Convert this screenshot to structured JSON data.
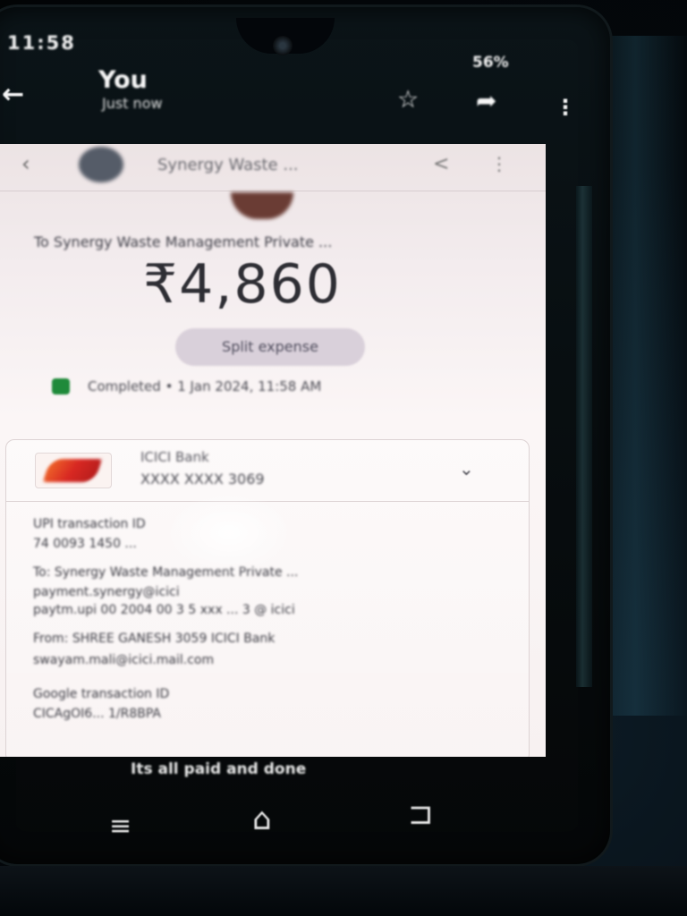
{
  "status_bar": {
    "time": "11:58",
    "right": "56%"
  },
  "app_bar": {
    "title": "You",
    "subtitle": "Just now"
  },
  "icons": {
    "back": "arrow-left-icon",
    "star": "star-icon",
    "share": "share-icon",
    "more": "more-vert-icon"
  },
  "transaction": {
    "merchant_short": "Synergy Waste ...",
    "paid_to": "To Synergy Waste Management Private ...",
    "amount": "₹4,860",
    "split_label": "Split expense",
    "status_text": "Completed • 1 Jan 2024, 11:58 AM",
    "bank_name": "ICICI Bank",
    "account": "XXXX XXXX 3069",
    "details": [
      "UPI transaction ID",
      "74 0093 1450 ...",
      "To: Synergy Waste Management Private ...",
      "payment.synergy@icici",
      "paytm.upi 00 2004 00 3 5 xxx ... 3 @ icici",
      "From: SHREE GANESH 3059 ICICI Bank",
      "swayam.mali@icici.mail.com",
      "Google transaction ID",
      "CICAgOI6... 1/R8BPA"
    ]
  },
  "nav": {
    "hint": "Its all paid and done",
    "recent": "≡",
    "home": "⌂",
    "back": "⊐"
  },
  "colors": {
    "screen_bg": "#f6f0f0",
    "amount_text": "#2e2e34",
    "completed_green": "#1f8a3a",
    "bank_accent": "#d82822",
    "chip_bg": "#d9d0da"
  }
}
